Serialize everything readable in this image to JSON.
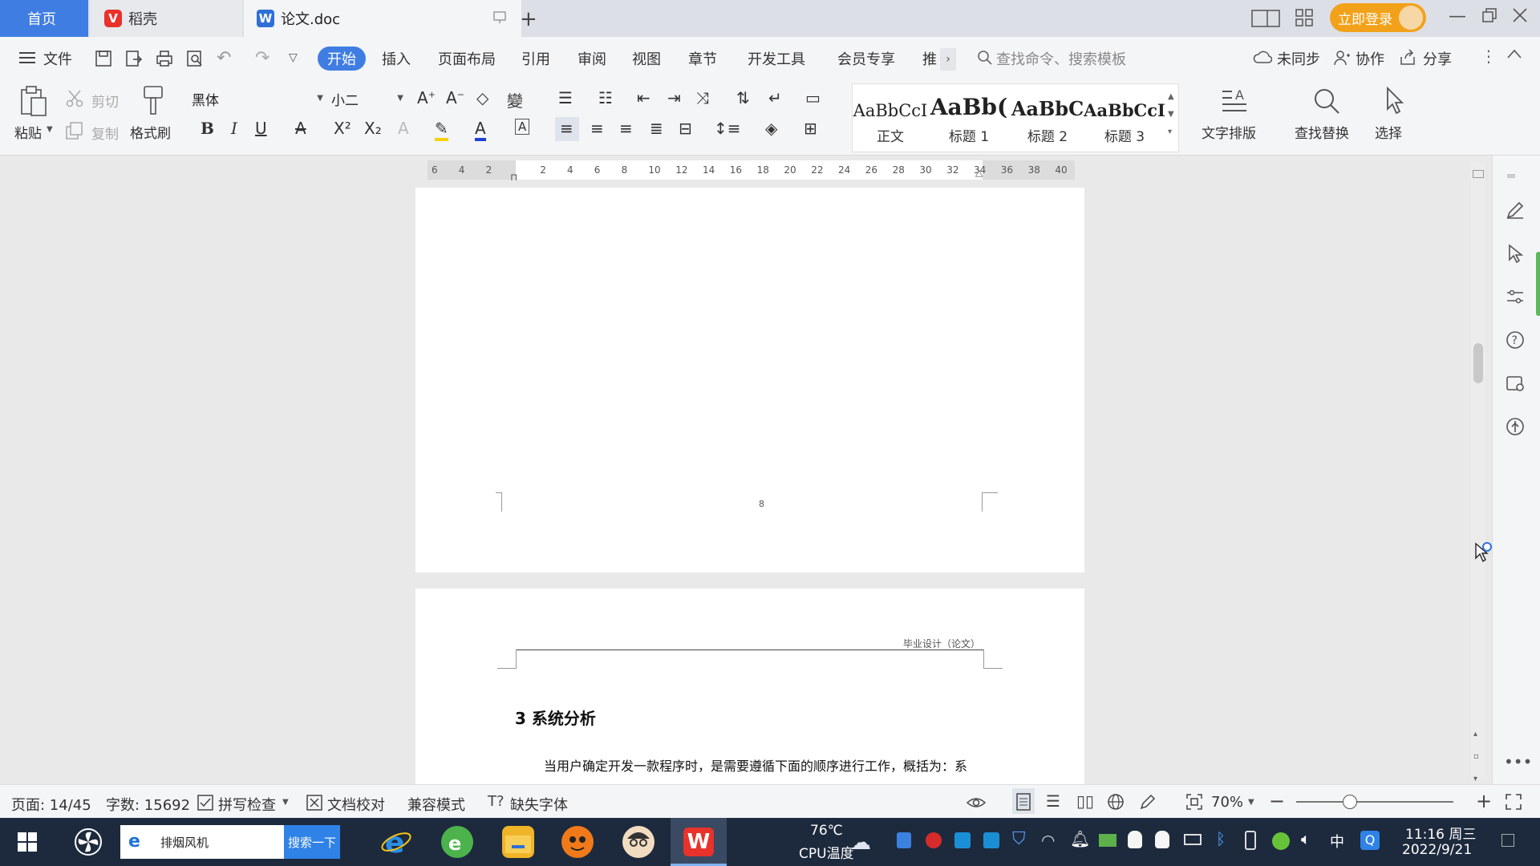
{
  "tabs": {
    "home": "首页",
    "daoke": "稻壳",
    "doc": "论文.doc",
    "login": "立即登录"
  },
  "menu": {
    "file": "文件",
    "start": "开始",
    "insert": "插入",
    "layout": "页面布局",
    "reference": "引用",
    "review": "审阅",
    "view": "视图",
    "chapter": "章节",
    "devtools": "开发工具",
    "member": "会员专享",
    "more": "推",
    "search_placeholder": "查找命令、搜索模板",
    "unsync": "未同步",
    "collab": "协作",
    "share": "分享"
  },
  "ribbon": {
    "paste": "粘贴",
    "cut": "剪切",
    "copy": "复制",
    "format_painter": "格式刷",
    "font": "黑体",
    "size": "小二",
    "styles": [
      {
        "preview": "AaBbCcI",
        "label": "正文"
      },
      {
        "preview": "AaBb(",
        "label": "标题 1"
      },
      {
        "preview": "AaBbC",
        "label": "标题 2"
      },
      {
        "preview": "AaBbCcI",
        "label": "标题 3"
      }
    ],
    "text_layout": "文字排版",
    "find_replace": "查找替换",
    "select": "选择"
  },
  "ruler": {
    "ticks": [
      "6",
      "4",
      "2",
      "",
      "2",
      "4",
      "6",
      "8",
      "10",
      "12",
      "14",
      "16",
      "18",
      "20",
      "22",
      "24",
      "26",
      "28",
      "30",
      "32",
      "34",
      "36",
      "38",
      "40"
    ]
  },
  "document": {
    "page_number": "8",
    "header_text": "毕业设计（论文）",
    "heading": "3 系统分析",
    "body_line": "当用户确定开发一款程序时，是需要遵循下面的顺序进行工作，概括为：系"
  },
  "status": {
    "page": "页面: 14/45",
    "words": "字数: 15692",
    "spell": "拼写检查",
    "proof": "文档校对",
    "compat": "兼容模式",
    "missing_font": "缺失字体",
    "zoom": "70%"
  },
  "taskbar": {
    "search_text": "排烟风机",
    "search_button": "搜索一下",
    "temp": "76℃",
    "cpu": "CPU温度",
    "ime": "中",
    "time": "11:16 周三",
    "date": "2022/9/21"
  },
  "colors": {
    "accent": "#3f7de3",
    "login": "#f2a21a",
    "taskbar": "#1d2a3d"
  }
}
